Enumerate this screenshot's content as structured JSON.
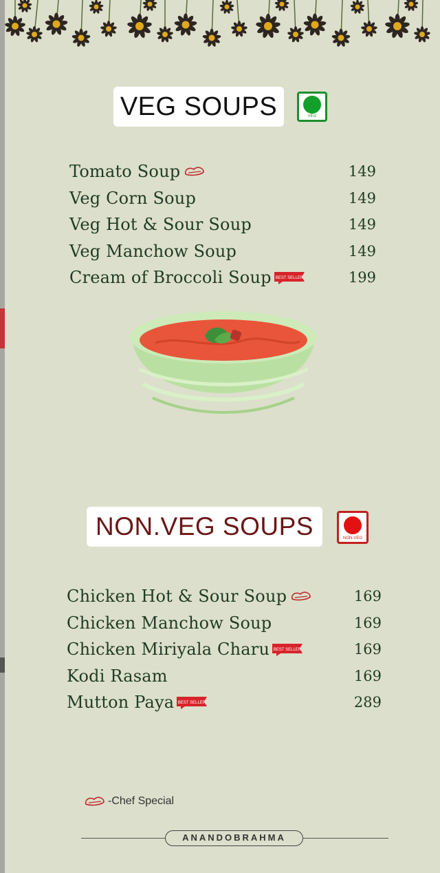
{
  "veg_section": {
    "title": "VEG SOUPS",
    "mark_label": "VEG",
    "items": [
      {
        "name": "Tomato Soup",
        "price": "149",
        "chef_special": true,
        "best_seller": false
      },
      {
        "name": "Veg Corn Soup",
        "price": "149",
        "chef_special": false,
        "best_seller": false
      },
      {
        "name": "Veg Hot & Sour Soup",
        "price": "149",
        "chef_special": false,
        "best_seller": false
      },
      {
        "name": "Veg Manchow Soup",
        "price": "149",
        "chef_special": false,
        "best_seller": false
      },
      {
        "name": "Cream of Broccoli Soup",
        "price": "199",
        "chef_special": false,
        "best_seller": true
      }
    ]
  },
  "nonveg_section": {
    "title": "NON.VEG SOUPS",
    "mark_label": "NON-VEG",
    "items": [
      {
        "name": "Chicken Hot & Sour Soup",
        "price": "169",
        "chef_special": true,
        "best_seller": false
      },
      {
        "name": "Chicken Manchow Soup",
        "price": "169",
        "chef_special": false,
        "best_seller": false
      },
      {
        "name": "Chicken Miriyala Charu",
        "price": "169",
        "chef_special": false,
        "best_seller": true
      },
      {
        "name": "Kodi Rasam",
        "price": "169",
        "chef_special": false,
        "best_seller": false
      },
      {
        "name": "Mutton Paya",
        "price": "289",
        "chef_special": false,
        "best_seller": true
      }
    ]
  },
  "badges": {
    "best_seller_label": "BEST SELLER"
  },
  "legend": {
    "text": "-Chef Special",
    "icon": "chef-hat-icon"
  },
  "brand": {
    "name": "ANANDOBRAHMA"
  },
  "colors": {
    "background": "#dcdfcb",
    "veg_green": "#12a02a",
    "nonveg_red": "#e31212",
    "text": "#1f3b25"
  }
}
